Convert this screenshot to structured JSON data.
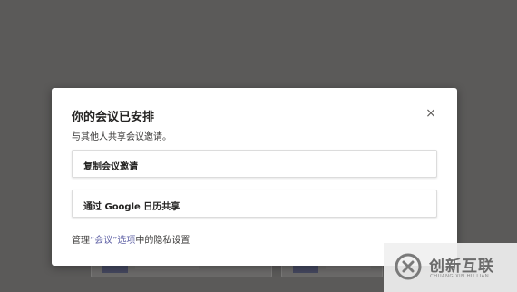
{
  "dialog": {
    "title": "你的会议已安排",
    "subtitle": "与其他人共享会议邀请。",
    "close_glyph": "×",
    "options": [
      {
        "label": "复制会议邀请"
      },
      {
        "label": "通过 Google 日历共享"
      }
    ],
    "manage": {
      "prefix": "管理",
      "link": "“会议”选项",
      "suffix": "中的隐私设置"
    }
  },
  "watermark": {
    "name": "创新互联",
    "subtitle": "CHUANG XIN HU LIAN"
  },
  "colors": {
    "backdrop": "#5b5a59",
    "link": "#6264a7"
  }
}
